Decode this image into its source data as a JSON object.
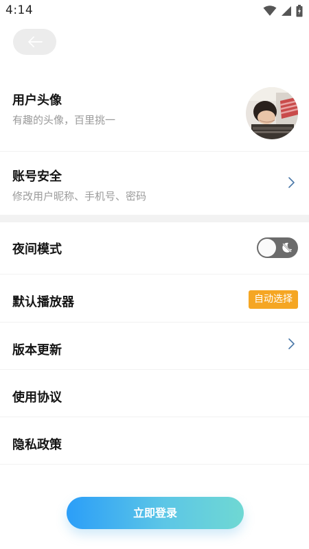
{
  "status_bar": {
    "time": "4:14"
  },
  "header": {
    "back_icon": "arrow-left-icon"
  },
  "profile": {
    "avatar_row": {
      "title": "用户头像",
      "subtitle": "有趣的头像，百里挑一"
    },
    "account_row": {
      "title": "账号安全",
      "subtitle": "修改用户昵称、手机号、密码"
    }
  },
  "settings": {
    "night_mode": {
      "title": "夜间模式",
      "enabled": false
    },
    "default_player": {
      "title": "默认播放器",
      "value": "自动选择"
    },
    "version_update": {
      "title": "版本更新"
    },
    "terms": {
      "title": "使用协议"
    },
    "privacy": {
      "title": "隐私政策"
    }
  },
  "login": {
    "label": "立即登录"
  },
  "colors": {
    "badge": "#f5a623",
    "login_gradient_start": "#2b9ef8",
    "login_gradient_end": "#6fd8d3",
    "chevron": "#4a78a8"
  }
}
